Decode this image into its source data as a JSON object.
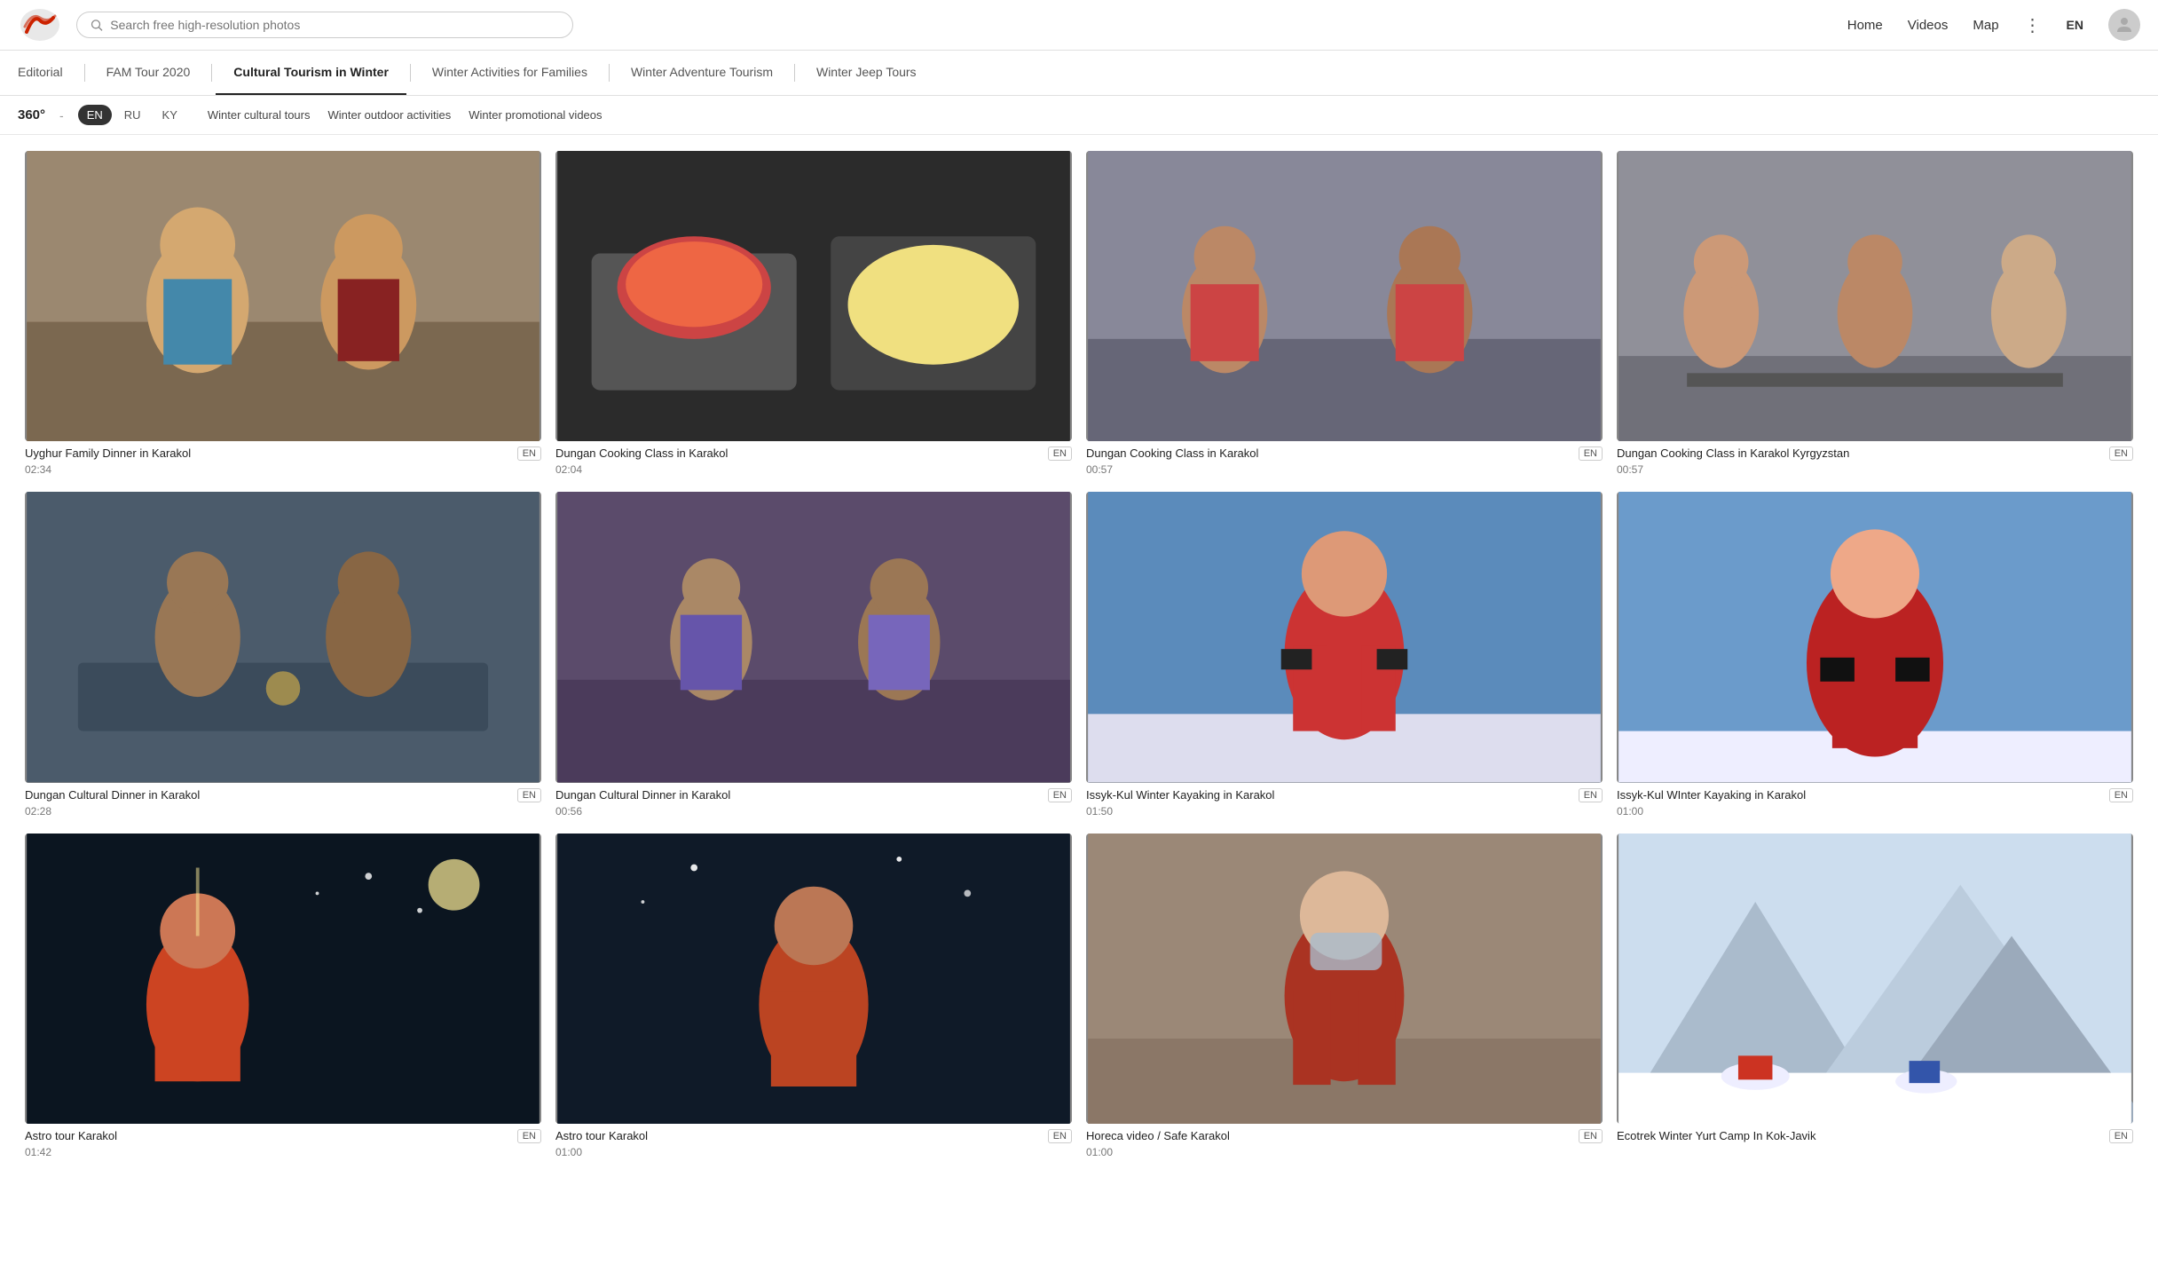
{
  "header": {
    "search_placeholder": "Search free high-resolution photos",
    "nav": {
      "home": "Home",
      "videos": "Videos",
      "map": "Map"
    },
    "language": "EN"
  },
  "category_tabs": [
    {
      "id": "editorial",
      "label": "Editorial",
      "active": false
    },
    {
      "id": "fam-tour",
      "label": "FAM Tour 2020",
      "active": false
    },
    {
      "id": "cultural-tourism",
      "label": "Cultural Tourism in Winter",
      "active": true
    },
    {
      "id": "winter-families",
      "label": "Winter Activities for Families",
      "active": false
    },
    {
      "id": "winter-adventure",
      "label": "Winter Adventure Tourism",
      "active": false
    },
    {
      "id": "winter-jeep",
      "label": "Winter Jeep Tours",
      "active": false
    }
  ],
  "filter_bar": {
    "label_360": "360°",
    "dash": "-",
    "languages": [
      {
        "code": "EN",
        "active": true
      },
      {
        "code": "RU",
        "active": false
      },
      {
        "code": "KY",
        "active": false
      }
    ],
    "tags": [
      "Winter cultural tours",
      "Winter outdoor activities",
      "Winter promotional videos"
    ]
  },
  "videos": [
    {
      "id": 1,
      "title": "Uyghur Family Dinner in Karakol",
      "duration": "02:34",
      "lang": "EN",
      "thumb_class": "thumb-1"
    },
    {
      "id": 2,
      "title": "Dungan Cooking Class in Karakol",
      "duration": "02:04",
      "lang": "EN",
      "thumb_class": "thumb-2"
    },
    {
      "id": 3,
      "title": "Dungan Cooking Class in Karakol",
      "duration": "00:57",
      "lang": "EN",
      "thumb_class": "thumb-3"
    },
    {
      "id": 4,
      "title": "Dungan Cooking Class in Karakol Kyrgyzstan",
      "duration": "00:57",
      "lang": "EN",
      "thumb_class": "thumb-4"
    },
    {
      "id": 5,
      "title": "Dungan Cultural Dinner in Karakol",
      "duration": "02:28",
      "lang": "EN",
      "thumb_class": "thumb-5"
    },
    {
      "id": 6,
      "title": "Dungan Cultural Dinner in Karakol",
      "duration": "00:56",
      "lang": "EN",
      "thumb_class": "thumb-6"
    },
    {
      "id": 7,
      "title": "Issyk-Kul Winter Kayaking in Karakol",
      "duration": "01:50",
      "lang": "EN",
      "thumb_class": "thumb-7"
    },
    {
      "id": 8,
      "title": "Issyk-Kul WInter Kayaking in Karakol",
      "duration": "01:00",
      "lang": "EN",
      "thumb_class": "thumb-8"
    },
    {
      "id": 9,
      "title": "Astro tour Karakol",
      "duration": "01:42",
      "lang": "EN",
      "thumb_class": "thumb-9"
    },
    {
      "id": 10,
      "title": "Astro tour Karakol",
      "duration": "01:00",
      "lang": "EN",
      "thumb_class": "thumb-10"
    },
    {
      "id": 11,
      "title": "Horeca video / Safe Karakol",
      "duration": "01:00",
      "lang": "EN",
      "thumb_class": "thumb-11"
    },
    {
      "id": 12,
      "title": "Ecotrek Winter Yurt Camp In Kok-Javik",
      "duration": "",
      "lang": "EN",
      "thumb_class": "thumb-12"
    }
  ]
}
